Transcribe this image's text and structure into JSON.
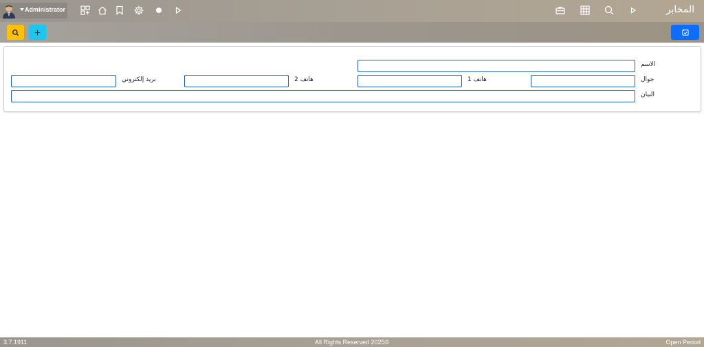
{
  "app": {
    "title": "المخابر"
  },
  "user": {
    "name": "Administrator"
  },
  "icons": {
    "left": [
      "apps-icon",
      "home-icon",
      "bookmark-icon",
      "gear-icon",
      "record-dot-icon",
      "play-icon"
    ],
    "right": [
      "briefcase-icon",
      "grid-icon",
      "search-icon",
      "play-icon"
    ]
  },
  "toolbar": {
    "search_icon": "search-icon",
    "add_icon": "plus-icon",
    "save_icon": "calendar-check-icon"
  },
  "form": {
    "name_label": "الاسم",
    "mobile_label": "جوال",
    "phone1_label": "هاتف 1",
    "phone2_label": "هاتف 2",
    "email_label": "بريد إلكتروني",
    "statement_label": "البيان",
    "name_value": "",
    "mobile_value": "",
    "phone1_value": "",
    "phone2_value": "",
    "email_value": "",
    "statement_value": ""
  },
  "footer": {
    "version": "3.7.1911",
    "copyright": "All Rights Reserved 2025©",
    "period": "Open Period"
  },
  "colors": {
    "search_button": "#ffc107",
    "add_button": "#1bc7ef",
    "save_button": "#0d6efd",
    "field_border": "#1e5fb8"
  }
}
